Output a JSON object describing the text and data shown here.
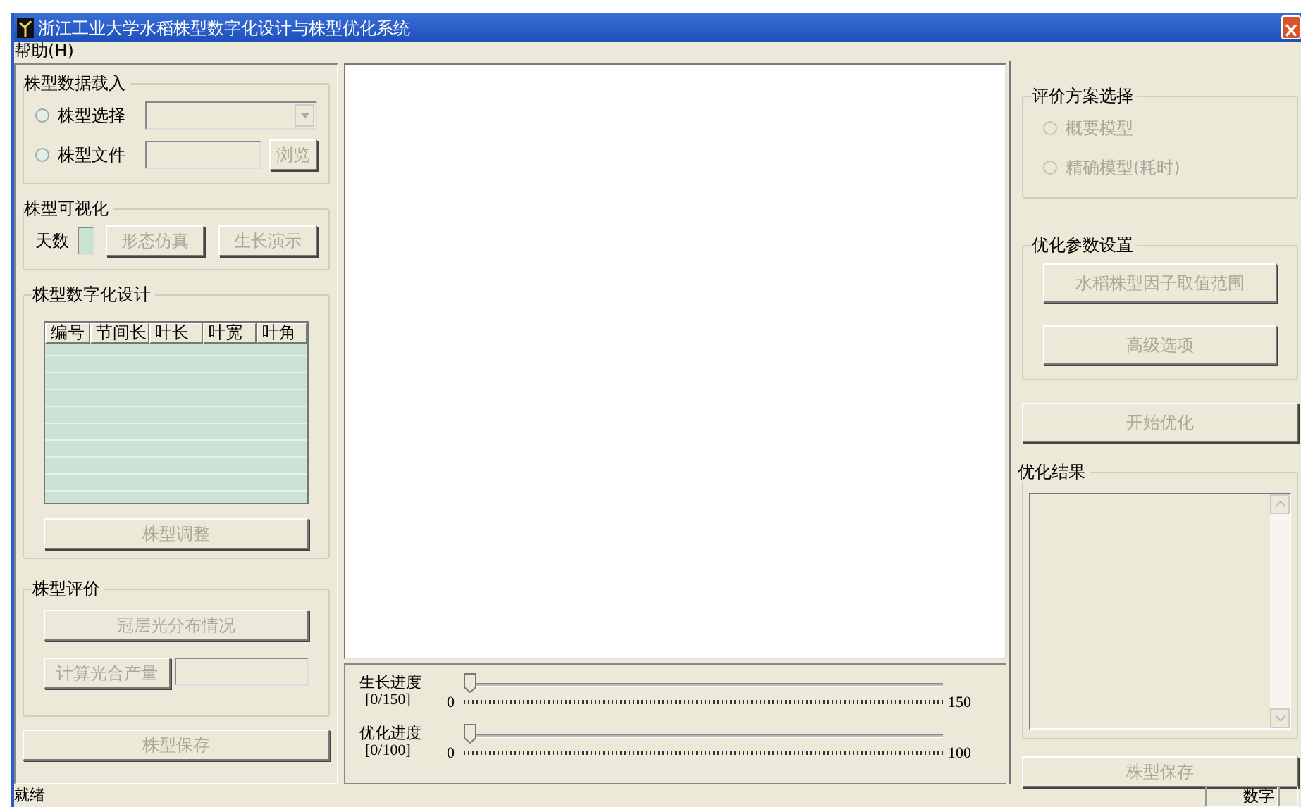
{
  "window": {
    "title": "浙江工业大学水稻株型数字化设计与株型优化系统"
  },
  "menu": [
    {
      "label": "帮助(H)"
    }
  ],
  "data_load": {
    "title": "株型数据载入",
    "rows": [
      {
        "kind": "combo",
        "label": "株型选择",
        "selected": false
      },
      {
        "kind": "file",
        "label": "株型文件",
        "selected": false,
        "button": {
          "label": "浏览",
          "disabled": true
        }
      }
    ]
  },
  "visualization": {
    "title": "株型可视化",
    "days_label": "天数",
    "buttons": [
      {
        "label": "形态仿真",
        "disabled": true
      },
      {
        "label": "生长演示",
        "disabled": true
      }
    ]
  },
  "digital_design": {
    "title": "株型数字化设计",
    "columns": [
      "编号",
      "节间长",
      "叶长",
      "叶宽",
      "叶角"
    ],
    "button": {
      "label": "株型调整",
      "disabled": true
    }
  },
  "evaluation": {
    "title": "株型评价",
    "buttons": [
      {
        "label": "冠层光分布情况",
        "disabled": true
      },
      {
        "label": "计算光合产量",
        "disabled": true
      }
    ]
  },
  "left_save": {
    "label": "株型保存",
    "disabled": true
  },
  "sliders": [
    {
      "label": "生长进度",
      "range": "[0/150]",
      "min": "0",
      "max": "150",
      "level": 0
    },
    {
      "label": "优化进度",
      "range": "[0/100]",
      "min": "0",
      "max": "100",
      "level": 0
    }
  ],
  "scheme": {
    "title": "评价方案选择",
    "options": [
      {
        "label": "概要模型",
        "selected": false,
        "disabled": true
      },
      {
        "label": "精确模型(耗时)",
        "selected": false,
        "disabled": true
      }
    ]
  },
  "parameters": {
    "title": "优化参数设置",
    "buttons": [
      {
        "label": "水稻株型因子取值范围",
        "disabled": true
      },
      {
        "label": "高级选项",
        "disabled": true
      }
    ]
  },
  "start": {
    "label": "开始优化",
    "disabled": true
  },
  "results": {
    "title": "优化结果"
  },
  "right_save": {
    "label": "株型保存",
    "disabled": true
  },
  "status_bar": {
    "message": "就绪",
    "indicator": "数字"
  }
}
